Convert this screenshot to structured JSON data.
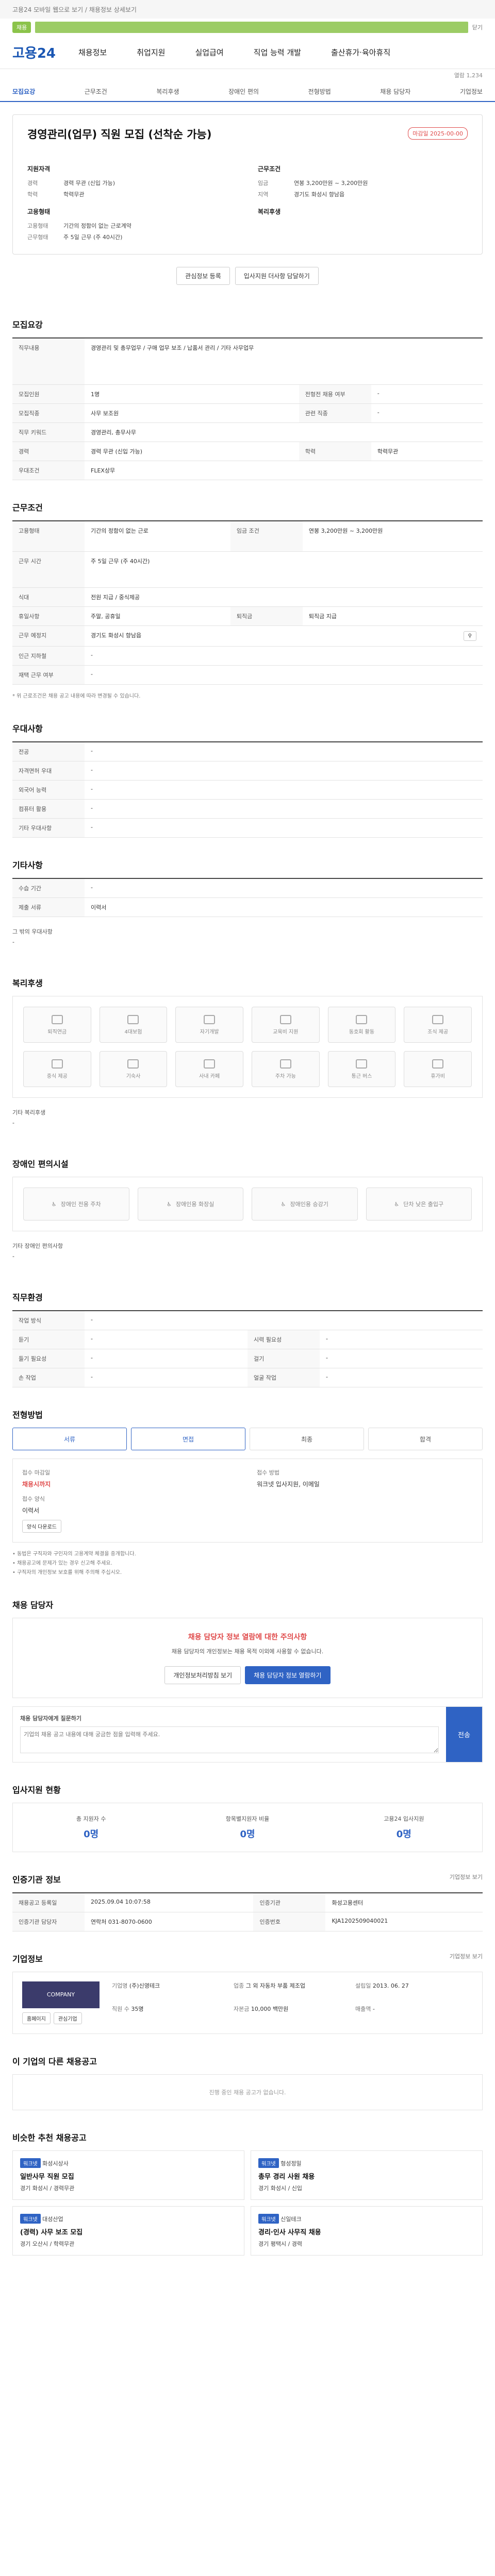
{
  "topbar": {
    "text": "고용24 모바일 웹으로 보기 / 채용정보 상세보기"
  },
  "greenbar": {
    "pill": "채용",
    "right": "닫기"
  },
  "header": {
    "logo": "고용24",
    "nav": [
      "채용정보",
      "취업지원",
      "실업급여",
      "직업 능력 개발",
      "출산휴가·육아휴직"
    ]
  },
  "notice_count": "열람 1,234",
  "tabs": [
    "모집요강",
    "근무조건",
    "복리후생",
    "장애인 편의",
    "전형방법",
    "채용 담당자",
    "기업정보"
  ],
  "job": {
    "title": "경영관리(업무) 직원 모집 (선착순 가능)",
    "badge": "마감일 2025-00-00",
    "left_heading": "지원자격",
    "left": [
      {
        "k": "경력",
        "v": "경력 무관 (신입 가능)"
      },
      {
        "k": "학력",
        "v": "학력무관"
      }
    ],
    "left2_heading": "고용형태",
    "left2": [
      {
        "k": "고용형태",
        "v": "기간의 정함이 없는 근로계약"
      },
      {
        "k": "근무형태",
        "v": "주 5일 근무 (주 40시간)"
      }
    ],
    "right_heading": "근무조건",
    "right": [
      {
        "k": "임금",
        "v": "연봉 3,200만원 ~ 3,200만원"
      },
      {
        "k": "지역",
        "v": "경기도 화성시 향남읍"
      }
    ],
    "right2_heading": "복리후생",
    "right2": []
  },
  "actions": {
    "interest": "관심정보 등록",
    "share": "입사지원 더사항 담달하기"
  },
  "recruit": {
    "heading": "모집요강",
    "duties_label": "직무내용",
    "duties": "경영관리 및 총무업무 / 구매 업무 보조 / 납품서 관리 / 기타 사무업무",
    "rows": [
      {
        "k": "모집인원",
        "v": "1명",
        "k2": "전형전 채용 여부",
        "v2": "-"
      },
      {
        "k": "모집직종",
        "v": "사무 보조원",
        "k2": "관련 직종",
        "v2": "-"
      },
      {
        "k": "직무 키워드",
        "v": "경영관리, 총무사무",
        "k2": "",
        "v2": ""
      },
      {
        "k": "경력",
        "v": "경력 무관 (신입 가능)",
        "k2": "학력",
        "v2": "학력무관"
      },
      {
        "k": "우대조건",
        "v": "FLEX상무",
        "k2": "",
        "v2": ""
      }
    ]
  },
  "work": {
    "heading": "근무조건",
    "rows": [
      {
        "k": "고용형태",
        "v": "기간의 정함이 없는 근로",
        "k2": "임금 조건",
        "v2": "연봉 3,200만원 ~ 3,200만원"
      },
      {
        "k": "근무 시간",
        "v": "주 5일 근무 (주 40시간)",
        "k2": "",
        "v2": ""
      },
      {
        "k": "식대",
        "v": "전원 지급 / 중식제공",
        "k2": "",
        "v2": ""
      },
      {
        "k": "휴일사항",
        "v": "주말, 공휴일",
        "k2": "퇴직금",
        "v2": "퇴직금 지급"
      },
      {
        "k": "근무 예정지",
        "v": "경기도 화성시 향남읍",
        "k2": "",
        "v2": ""
      },
      {
        "k": "인근 지하철",
        "v": "-",
        "k2": "",
        "v2": ""
      },
      {
        "k": "재택 근무 여부",
        "v": "-",
        "k2": "",
        "v2": ""
      }
    ],
    "note": "* 위 근로조건은 채용 공고 내용에 따라 변경될 수 있습니다."
  },
  "prefs": {
    "heading": "우대사항",
    "rows": [
      {
        "k": "전공",
        "v": "-"
      },
      {
        "k": "자격면허 우대",
        "v": "-"
      },
      {
        "k": "외국어 능력",
        "v": "-"
      },
      {
        "k": "컴퓨터 활용",
        "v": "-"
      },
      {
        "k": "기타 우대사항",
        "v": "-"
      }
    ]
  },
  "other": {
    "heading": "기타사항",
    "rows": [
      {
        "k": "수습 기간",
        "v": "-"
      },
      {
        "k": "제출 서류",
        "v": "이력서"
      }
    ],
    "extra_label": "그 밖의 우대사항",
    "extra_value": "-"
  },
  "benefits": {
    "heading": "복리후생",
    "items": [
      "퇴직연금",
      "4대보험",
      "자기개발",
      "교육비 지원",
      "동호회 활동",
      "조식 제공",
      "중식 제공",
      "기숙사",
      "사내 카페",
      "주차 가능",
      "통근 버스",
      "휴가비"
    ],
    "note_label": "기타 복리후생",
    "note_value": "-"
  },
  "disability": {
    "heading": "장애인 편의시설",
    "items": [
      "장애인 전용 주차",
      "장애인용 화장실",
      "장애인용 승강기",
      "단차 낮은 출입구"
    ],
    "note_label": "기타 장애인 편의사항",
    "note_value": "-"
  },
  "hiring_process": {
    "heading": "직무환경",
    "rows": [
      {
        "k": "작업 방식",
        "v": "-",
        "k2": "",
        "v2": ""
      },
      {
        "k": "듣기",
        "v": "-",
        "k2": "시력 필요성",
        "v2": "-"
      },
      {
        "k": "들기 필요성",
        "v": "-",
        "k2": "걸기",
        "v2": "-"
      },
      {
        "k": "손 작업",
        "v": "-",
        "k2": "얼굴 작업",
        "v2": "-"
      }
    ]
  },
  "apply": {
    "heading": "전형방법",
    "steps": [
      "서류",
      "면접",
      "최종",
      "합격"
    ],
    "deadline_label": "접수 마감일",
    "deadline_value": "채용시까지",
    "method_label": "접수 방법",
    "method_value": "워크넷 입사지원, 이메일",
    "form_label": "접수 양식",
    "form_value": "이력서",
    "download": "양식 다운로드",
    "notes": [
      "• 동법은 구직자와 구인자의 고용계약 체결을 중개합니다.",
      "• 채용공고에 문제가 있는 경우 신고해 주세요.",
      "• 구직자의 개인정보 보호를 위해 주의해 주십시오."
    ]
  },
  "contact": {
    "heading": "채용 담당자",
    "warn_title": "채용 담당자 정보 열람에 대한 주의사항",
    "warn_text": "채용 담당자의 개인정보는 채용 목적 이외에 사용할 수 없습니다.",
    "btn1": "개인정보처리방침 보기",
    "btn2": "채용 담당자 정보 열람하기",
    "inquiry_label": "채용 담당자에게 질문하기",
    "inquiry_placeholder": "기업의 채용 공고 내용에 대해 궁금한 점을 입력해 주세요.",
    "send": "전송"
  },
  "status": {
    "heading": "입사지원 현황",
    "cells": [
      {
        "label": "총 지원자 수",
        "value": "0명"
      },
      {
        "label": "항목별지원자 비율",
        "value": "0명"
      },
      {
        "label": "고용24 입사지원",
        "value": "0명"
      }
    ]
  },
  "basic": {
    "heading": "인증기관 정보",
    "link": "기업정보 보기",
    "rows": [
      {
        "k": "채용공고 등록일",
        "v": "2025.09.04 10:07:58",
        "k2": "인증기관",
        "v2": "화성고용센터"
      },
      {
        "k": "인증기관 담당자",
        "v": "연락처 031-8070-0600",
        "k2": "인증번호",
        "v2": "KJA1202509040021"
      }
    ]
  },
  "company": {
    "heading": "기업정보",
    "link": "기업정보 보기",
    "logo": "COMPANY",
    "btn1": "홈페이지",
    "btn2": "관심기업",
    "info": [
      {
        "k": "기업명",
        "v": "(주)신영테크"
      },
      {
        "k": "업종",
        "v": "그 외 자동차 부품 제조업"
      },
      {
        "k": "설립일",
        "v": "2013. 06. 27"
      },
      {
        "k": "직원 수",
        "v": "35명"
      },
      {
        "k": "자본금",
        "v": "10,000 백만원"
      },
      {
        "k": "매출액",
        "v": "-"
      }
    ]
  },
  "other_jobs": {
    "heading": "이 기업의 다른 채용공고",
    "empty": "진행 중인 채용 공고가 없습니다."
  },
  "recommended": {
    "heading": "비슷한 추천 채용공고",
    "items": [
      {
        "tag": "워크넷",
        "company": "화성시상사",
        "title": "일반사무 직원 모집",
        "meta": "경기 화성시 / 경력무관"
      },
      {
        "tag": "워크넷",
        "company": "형성정밀",
        "title": "총무 경리 사원 채용",
        "meta": "경기 화성시 / 신입"
      },
      {
        "tag": "워크넷",
        "company": "대성산업",
        "title": "(경력) 사무 보조 모집",
        "meta": "경기 오산시 / 학력무관"
      },
      {
        "tag": "워크넷",
        "company": "신일테크",
        "title": "경리·인사 사무직 채용",
        "meta": "경기 평택시 / 경력"
      }
    ]
  }
}
